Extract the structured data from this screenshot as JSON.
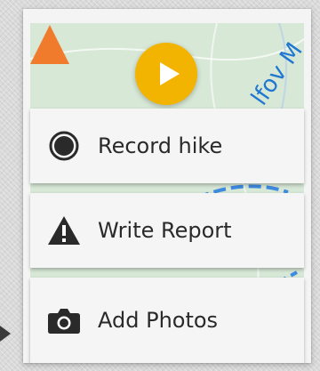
{
  "menu": {
    "items": [
      {
        "label": "Record hike",
        "icon": "record-icon"
      },
      {
        "label": "Write Report",
        "icon": "warning-icon"
      },
      {
        "label": "Add Photos",
        "icon": "camera-icon"
      }
    ]
  },
  "fab": {
    "icon": "play-icon",
    "color": "#f2b400"
  },
  "map": {
    "road_label": "Ilfov",
    "road_label_partial": "lfov M"
  },
  "colors": {
    "menu_bg": "#f5f5f5",
    "text": "#2a2a2a",
    "map_bg": "#d6e6d6",
    "trail": "#3f8be0",
    "marker": "#f07b2c"
  }
}
